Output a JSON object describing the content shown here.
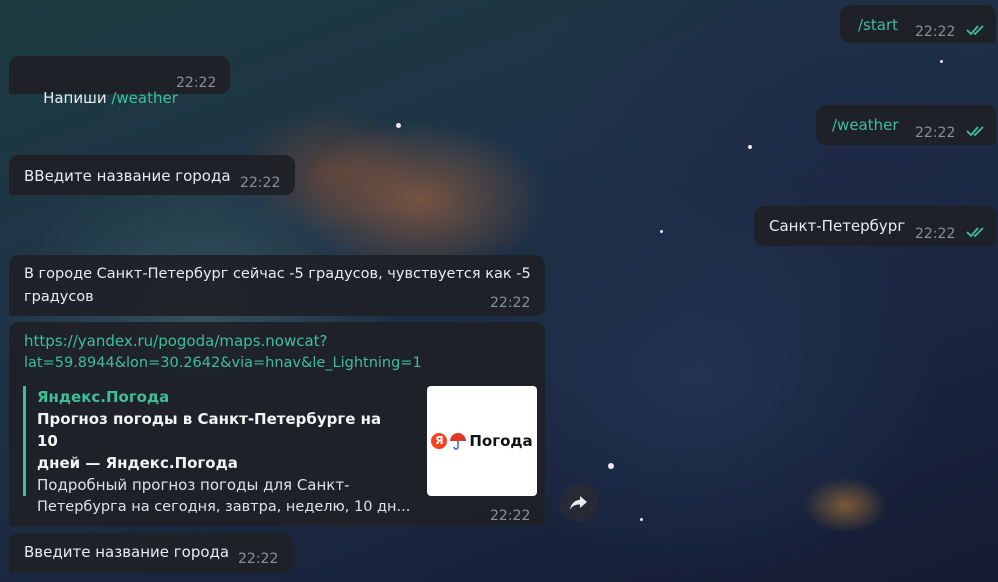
{
  "chat": {
    "out_start": {
      "text": "/start",
      "time": "22:22"
    },
    "in_write": {
      "prefix": "Напиши ",
      "cmd": "/weather",
      "time": "22:22"
    },
    "out_weather": {
      "text": "/weather",
      "time": "22:22"
    },
    "in_enter1": {
      "text": "ВВедите название города",
      "time": "22:22"
    },
    "out_city": {
      "text": "Санкт-Петербург",
      "time": "22:22"
    },
    "in_result": {
      "line1": "В городе Санкт-Петербург сейчас -5 градусов, чувствуется как -5",
      "line2": "градусов",
      "time": "22:22"
    },
    "in_link": {
      "url_line1": "https://yandex.ru/pogoda/maps.nowcat?",
      "url_line2": "lat=59.8944&lon=30.2642&via=hnav&le_Lightning=1",
      "site": "Яндекс.Погода",
      "title_line1": "Прогноз погоды в Санкт-Петербурге на 10",
      "title_line2": "дней — Яндекс.Погода",
      "desc_line1": "Подробный прогноз погоды для Санкт-",
      "desc_line2": "Петербурга на сегодня, завтра, неделю, 10 дн...",
      "logo_letter": "Я",
      "logo_text": "Погода",
      "time": "22:22"
    },
    "in_enter2": {
      "text": "Введите название города",
      "time": "22:22"
    }
  },
  "colors": {
    "accent": "#3fbf97",
    "bubble": "#1e2126",
    "time": "#8a9096"
  },
  "icons": {
    "read": "double-check-icon",
    "share": "share-arrow-icon"
  }
}
